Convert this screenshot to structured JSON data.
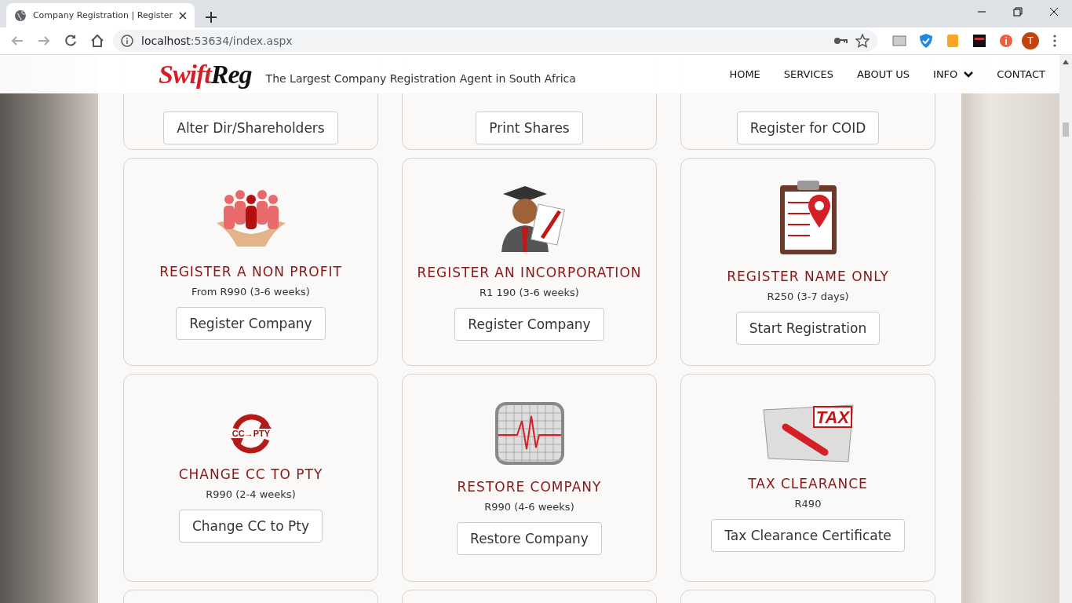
{
  "browser": {
    "tab_title": "Company Registration | Register",
    "url_host": "localhost",
    "url_rest": ":53634/index.aspx",
    "avatar_initial": "T"
  },
  "header": {
    "logo_a": "Swift",
    "logo_b": "Reg",
    "tagline": "The Largest Company Registration Agent in South Africa",
    "nav": [
      {
        "label": "HOME",
        "has_dropdown": false
      },
      {
        "label": "SERVICES",
        "has_dropdown": false
      },
      {
        "label": "ABOUT US",
        "has_dropdown": false
      },
      {
        "label": "INFO",
        "has_dropdown": true
      },
      {
        "label": "CONTACT",
        "has_dropdown": false
      }
    ]
  },
  "cards": [
    {
      "kind": "none",
      "button": "Alter Dir/Shareholders"
    },
    {
      "kind": "none",
      "button": "Print Shares"
    },
    {
      "kind": "none",
      "button": "Register for COID"
    },
    {
      "kind": "nonprofit",
      "title": "REGISTER A NON PROFIT",
      "price": "From R990 (3-6 weeks)",
      "button": "Register Company"
    },
    {
      "kind": "graduate",
      "title": "REGISTER AN INCORPORATION",
      "price": "R1 190 (3-6 weeks)",
      "button": "Register Company"
    },
    {
      "kind": "clipboard",
      "title": "REGISTER NAME ONLY",
      "price": "R250 (3-7 days)",
      "button": "Start Registration"
    },
    {
      "kind": "convert",
      "icon_text": "CC→PTY",
      "title": "CHANGE CC TO PTY",
      "price": "R990 (2-4 weeks)",
      "button": "Change CC to Pty"
    },
    {
      "kind": "monitor",
      "title": "RESTORE COMPANY",
      "price": "R990 (4-6 weeks)",
      "button": "Restore Company"
    },
    {
      "kind": "tax",
      "icon_text": "TAX",
      "title": "TAX CLEARANCE",
      "price": "R490",
      "button": "Tax Clearance Certificate"
    }
  ]
}
